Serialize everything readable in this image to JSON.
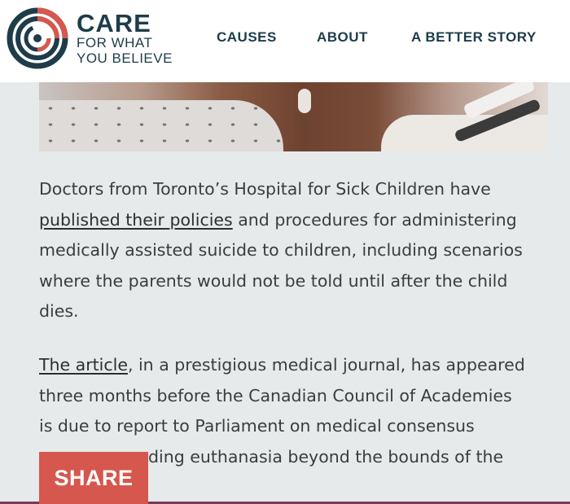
{
  "header": {
    "logo": {
      "line1": "CARE",
      "line2": "FOR WHAT",
      "line3": "YOU BELIEVE",
      "colors": {
        "navy": "#1e3c4a",
        "coral": "#d6574d"
      }
    },
    "nav": [
      {
        "label": "CAUSES"
      },
      {
        "label": "ABOUT"
      },
      {
        "label": "A BETTER STORY"
      }
    ]
  },
  "article": {
    "paragraph1": {
      "line1": "Doctors from Toronto’s Hospital for Sick Children have",
      "link": "published their policies",
      "line2_rest": " and procedures for administering",
      "line3": "medically assisted suicide to children, including scenarios",
      "line4": "where the parents would not be told until after the child",
      "line5": "dies."
    },
    "paragraph2": {
      "link": "The article",
      "line1_rest": ", in a prestigious medical journal, has appeared",
      "line2": "three months before the Canadian Council of Academies",
      "line3": "is due to report to Parliament on medical consensus",
      "line4_visible": "ding euthanasia beyond the bounds of the"
    }
  },
  "share": {
    "label": "SHARE",
    "color": "#d6574d"
  }
}
